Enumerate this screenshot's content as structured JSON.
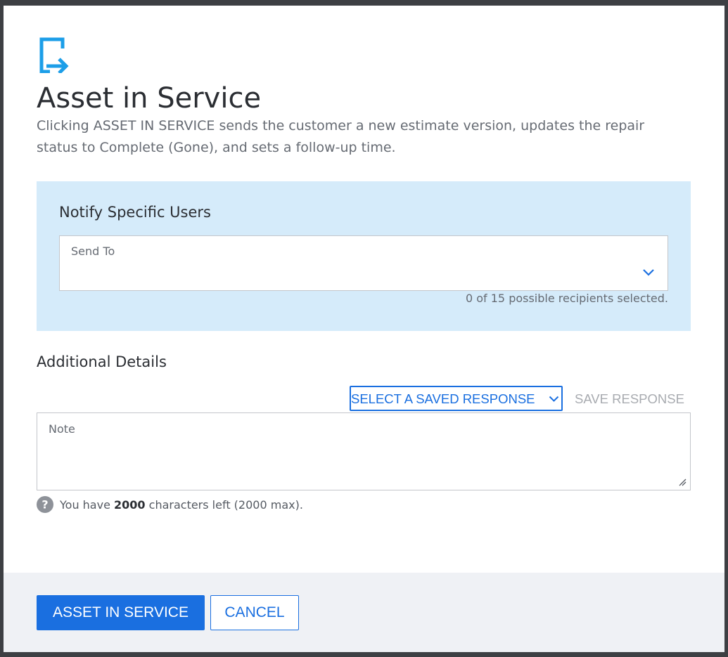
{
  "dialog": {
    "title": "Asset in Service",
    "description": "Clicking ASSET IN SERVICE sends the customer a new estimate version, updates the repair status to Complete (Gone), and sets a follow-up time.",
    "header_icon": "exit-arrow-icon",
    "accent_color": "#1a6fe0"
  },
  "notify": {
    "title": "Notify Specific Users",
    "send_to_label": "Send To",
    "send_to_value": "",
    "recipients_status": "0 of 15 possible recipients selected.",
    "panel_color": "#d5ebfa"
  },
  "details": {
    "title": "Additional Details",
    "saved_response_label": "SELECT A SAVED RESPONSE",
    "save_response_label": "SAVE RESPONSE",
    "note_label": "Note",
    "note_value": "",
    "chars_prefix": "You have",
    "chars_left": "2000",
    "chars_suffix": "characters left (2000 max)."
  },
  "footer": {
    "primary_label": "ASSET IN SERVICE",
    "cancel_label": "CANCEL"
  }
}
